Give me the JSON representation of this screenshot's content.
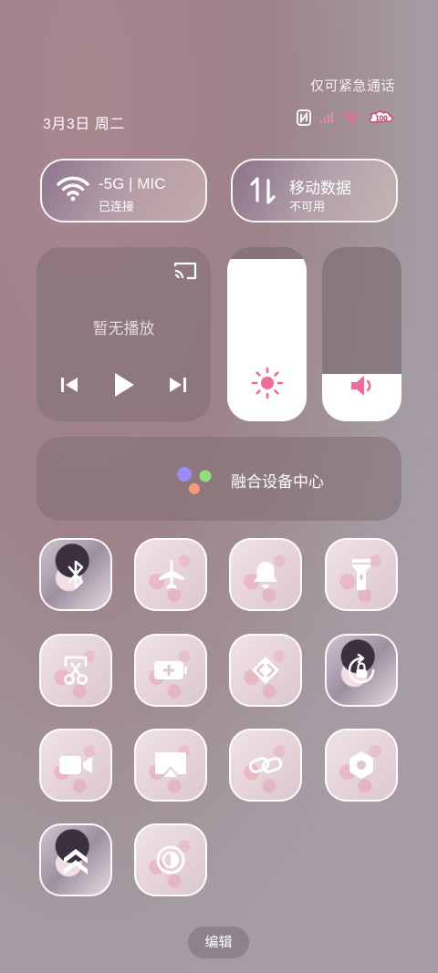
{
  "status": {
    "emergency_text": "仅可紧急通话",
    "date_text": "3月3日 周二",
    "icons": [
      "nfc-icon",
      "signal-icon",
      "wifi-icon",
      "battery-icon"
    ],
    "battery_level": "100"
  },
  "wifi_tile": {
    "title": "-5G | MIC",
    "subtitle": "已连接"
  },
  "mobile_data_tile": {
    "title": "移动数据",
    "subtitle": "不可用"
  },
  "media": {
    "now_playing": "暂无播放",
    "controls": [
      "previous-icon",
      "play-icon",
      "next-icon"
    ]
  },
  "brightness": {
    "level": 0.93
  },
  "volume": {
    "level": 0.27
  },
  "fusion": {
    "label": "融合设备中心"
  },
  "toggles": [
    "bluetooth-icon",
    "airplane-icon",
    "bell-icon",
    "flashlight-icon",
    "screenshot-icon",
    "battery-saver-icon",
    "direct-service-icon",
    "rotation-lock-icon",
    "screen-record-icon",
    "screen-cast-icon",
    "link-icon",
    "settings-hex-icon",
    "performance-icon",
    "dark-mode-icon"
  ],
  "edit_label": "编辑",
  "colors": {
    "accent": "#f06a9a",
    "tile_icon": "#ffffff"
  }
}
